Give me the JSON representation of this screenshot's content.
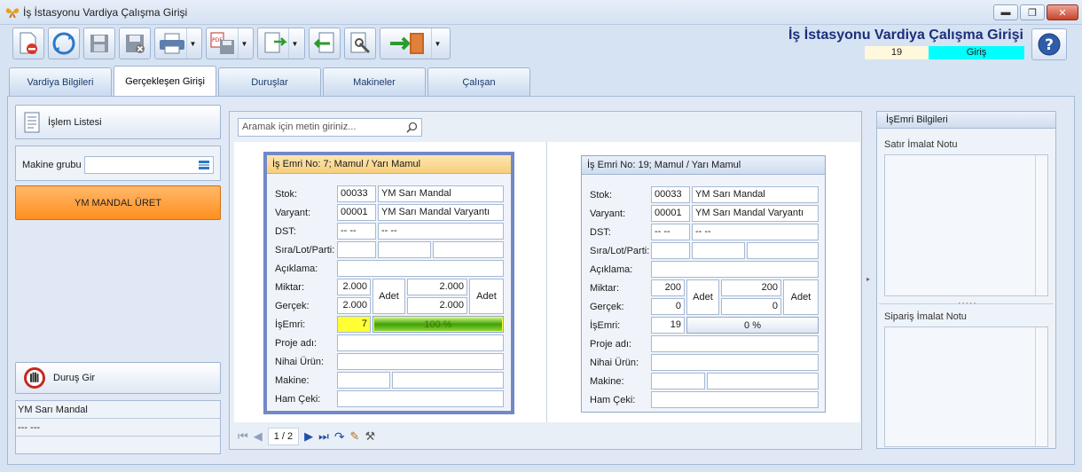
{
  "window": {
    "title": "İş İstasyonu Vardiya Çalışma Girişi"
  },
  "header": {
    "title": "İş İstasyonu Vardiya Çalışma Girişi",
    "number": "19",
    "status": "Giriş"
  },
  "tabs": [
    {
      "label": "Vardiya Bilgileri",
      "active": false
    },
    {
      "label": "Gerçekleşen Girişi",
      "active": true
    },
    {
      "label": "Duruşlar",
      "active": false
    },
    {
      "label": "Makineler",
      "active": false
    },
    {
      "label": "Çalışan",
      "active": false
    }
  ],
  "left": {
    "islem_listesi": "İşlem Listesi",
    "makine_grubu_label": "Makine grubu",
    "makine_grubu_value": "",
    "selected_machine": "YM MANDAL ÜRET",
    "durus_gir": "Duruş Gir",
    "info_line1": "YM Sarı Mandal",
    "info_line2": "--- ---",
    "info_line3": ""
  },
  "search": {
    "placeholder": "Aramak için metin giriniz..."
  },
  "labels": {
    "stok": "Stok:",
    "varyant": "Varyant:",
    "dst": "DST:",
    "sira": "Sıra/Lot/Parti:",
    "aciklama": "Açıklama:",
    "miktar": "Miktar:",
    "gercek": "Gerçek:",
    "isemri": "İşEmri:",
    "proje": "Proje adı:",
    "nihai": "Nihai Ürün:",
    "makine": "Makine:",
    "hamceki": "Ham Çeki:"
  },
  "cards": [
    {
      "header": "İş Emri No: 7; Mamul / Yarı Mamul",
      "stok_code": "00033",
      "stok_name": "YM Sarı Mandal",
      "varyant_code": "00001",
      "varyant_name": "YM Sarı Mandal Varyantı",
      "dst_1": "-- --",
      "dst_2": "-- --",
      "miktar_1": "2.000",
      "miktar_unit_1": "Adet",
      "miktar_2": "2.000",
      "miktar_unit_2": "Adet",
      "gercek_1": "2.000",
      "gercek_2": "2.000",
      "isemri_no": "7",
      "progress_text": "100 %",
      "progress": 1.0
    },
    {
      "header": "İş Emri No: 19; Mamul / Yarı Mamul",
      "stok_code": "00033",
      "stok_name": "YM Sarı Mandal",
      "varyant_code": "00001",
      "varyant_name": "YM Sarı Mandal Varyantı",
      "dst_1": "-- --",
      "dst_2": "-- --",
      "miktar_1": "200",
      "miktar_unit_1": "Adet",
      "miktar_2": "200",
      "miktar_unit_2": "Adet",
      "gercek_1": "0",
      "gercek_2": "0",
      "isemri_no": "19",
      "progress_text": "0 %",
      "progress": 0.0
    }
  ],
  "pager": {
    "page": "1 / 2"
  },
  "right": {
    "title": "İşEmri Bilgileri",
    "satir_notu": "Satır İmalat Notu",
    "siparis_notu": "Sipariş İmalat Notu"
  },
  "colors": {
    "status_bg": "#00ffff",
    "selected_machine": "#ff9a33",
    "highlight": "#ffff33"
  }
}
